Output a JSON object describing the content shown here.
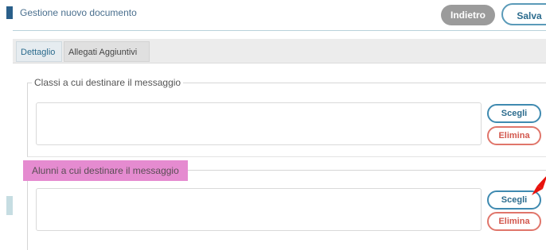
{
  "header": {
    "title": "Gestione nuovo documento",
    "back_label": "Indietro",
    "save_label": "Salva"
  },
  "tabs": [
    {
      "label": "Dettaglio",
      "active": true
    },
    {
      "label": "Allegati Aggiuntivi",
      "active": false
    }
  ],
  "sections": {
    "classi": {
      "legend": "Classi a cui destinare il messaggio",
      "choose_label": "Scegli",
      "delete_label": "Elimina"
    },
    "alunni": {
      "legend": "Alunni a cui destinare il messaggio",
      "choose_label": "Scegli",
      "delete_label": "Elimina",
      "highlight_color": "#e58bd0"
    }
  },
  "colors": {
    "accent": "#2b6b8d",
    "delete": "#d2574d",
    "back_button": "#9b9b9b",
    "annotation_arrow": "#e8120c"
  }
}
